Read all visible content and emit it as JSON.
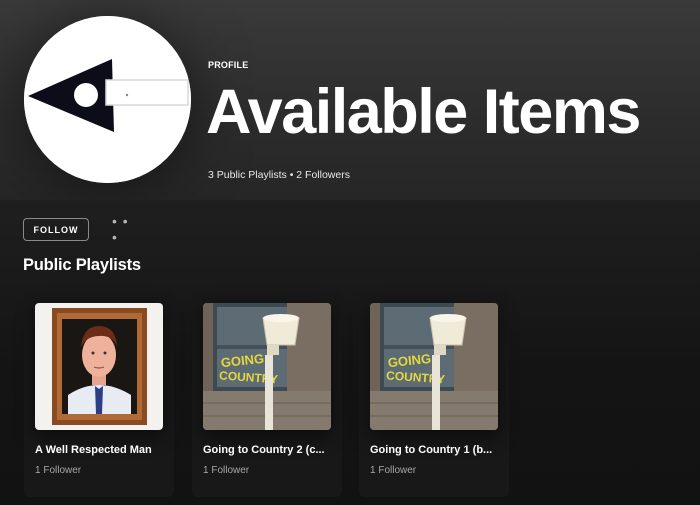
{
  "profile": {
    "type_label": "PROFILE",
    "title": "Available Items",
    "stats": "3 Public Playlists • 2 Followers",
    "avatar_icon": "arrow-logo-icon"
  },
  "actions": {
    "follow_label": "FOLLOW",
    "more_label": "• • •"
  },
  "section": {
    "title": "Public Playlists"
  },
  "playlists": [
    {
      "name": "A Well Respected Man",
      "followers": "1 Follower",
      "cover_icon": "portrait-painting-icon"
    },
    {
      "name": "Going to Country 2 (c...",
      "followers": "1 Follower",
      "cover_icon": "going-to-country-sign-icon"
    },
    {
      "name": "Going to Country 1 (b...",
      "followers": "1 Follower",
      "cover_icon": "going-to-country-sign-icon"
    }
  ],
  "colors": {
    "background": "#121212",
    "card": "#181818",
    "subtext": "#a7a7a7"
  }
}
